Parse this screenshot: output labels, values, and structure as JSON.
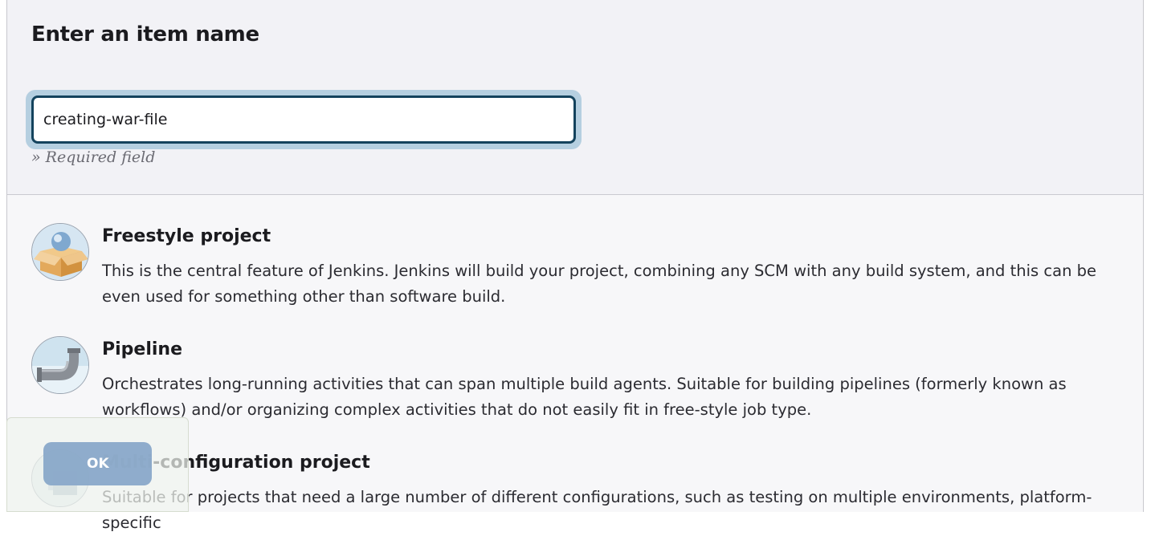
{
  "form": {
    "title": "Enter an item name",
    "item_name_value": "creating-war-file",
    "required_note": "» Required field"
  },
  "item_types": [
    {
      "name": "Freestyle project",
      "description": "This is the central feature of Jenkins. Jenkins will build your project, combining any SCM with any build system, and this can be even used for something other than software build.",
      "icon": "freestyle-project-icon"
    },
    {
      "name": "Pipeline",
      "description": "Orchestrates long-running activities that can span multiple build agents. Suitable for building pipelines (formerly known as workflows) and/or organizing complex activities that do not easily fit in free-style job type.",
      "icon": "pipeline-icon"
    },
    {
      "name": "Multi-configuration project",
      "description": "Suitable for projects that need a large number of different configurations, such as testing on multiple environments, platform-specific",
      "icon": "multi-configuration-icon"
    }
  ],
  "actions": {
    "ok_label": "OK"
  },
  "colors": {
    "input_border": "#14435d",
    "ok_button": "#8aa9ca"
  }
}
